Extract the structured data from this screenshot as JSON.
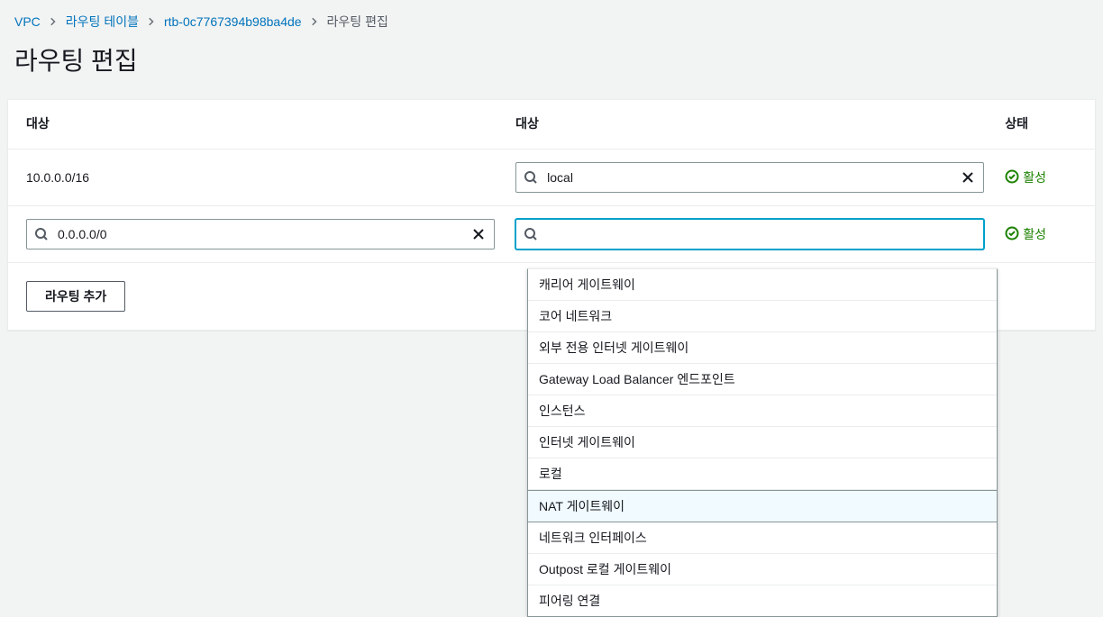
{
  "breadcrumb": {
    "items": [
      {
        "label": "VPC",
        "link": true
      },
      {
        "label": "라우팅 테이블",
        "link": true
      },
      {
        "label": "rtb-0c7767394b98ba4de",
        "link": true
      },
      {
        "label": "라우팅 편집",
        "link": false
      }
    ]
  },
  "page": {
    "title": "라우팅 편집"
  },
  "table": {
    "headers": {
      "destination": "대상",
      "target": "대상",
      "status": "상태"
    },
    "rows": [
      {
        "destination_value": "10.0.0.0/16",
        "destination_is_input": false,
        "target_value": "local",
        "status_label": "활성"
      },
      {
        "destination_value": "0.0.0.0/0",
        "destination_is_input": true,
        "target_value": "",
        "target_focused": true,
        "status_label": "활성"
      }
    ]
  },
  "buttons": {
    "add_route": "라우팅 추가"
  },
  "dropdown": {
    "options": [
      {
        "label": "캐리어 게이트웨이",
        "highlighted": false
      },
      {
        "label": "코어 네트워크",
        "highlighted": false
      },
      {
        "label": "외부 전용 인터넷 게이트웨이",
        "highlighted": false
      },
      {
        "label": "Gateway Load Balancer 엔드포인트",
        "highlighted": false
      },
      {
        "label": "인스턴스",
        "highlighted": false
      },
      {
        "label": "인터넷 게이트웨이",
        "highlighted": false
      },
      {
        "label": "로컬",
        "highlighted": false
      },
      {
        "label": "NAT 게이트웨이",
        "highlighted": true
      },
      {
        "label": "네트워크 인터페이스",
        "highlighted": false
      },
      {
        "label": "Outpost 로컬 게이트웨이",
        "highlighted": false
      },
      {
        "label": "피어링 연결",
        "highlighted": false
      }
    ]
  }
}
